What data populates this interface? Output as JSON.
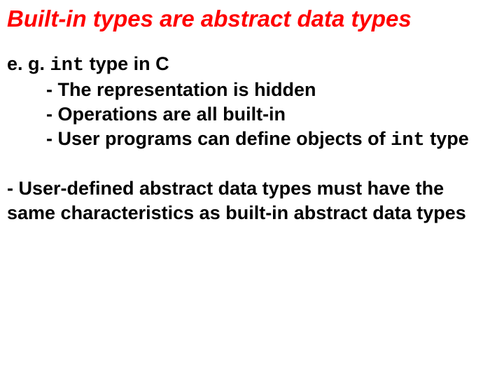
{
  "title": "Built-in types are abstract data types",
  "example": {
    "lead_prefix": "e. g. ",
    "code": "int",
    "lead_suffix": " type in C",
    "bullets": [
      "- The representation is hidden",
      "- Operations are all built-in",
      "- User programs can define objects of"
    ],
    "last_code": "int",
    "last_suffix": " type"
  },
  "paragraph": "- User-defined abstract data types must have the same characteristics as built-in abstract data types"
}
